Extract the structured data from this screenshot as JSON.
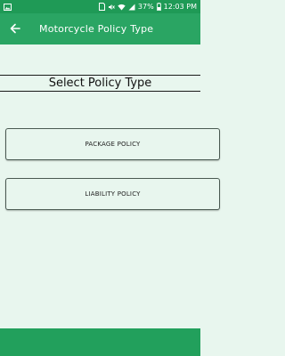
{
  "status_bar": {
    "signal_strength": "37%",
    "time": "12:03 PM",
    "icons": [
      "image-icon",
      "sim-icon",
      "mute-icon",
      "wifi-icon",
      "signal-icon",
      "battery-icon"
    ]
  },
  "app_bar": {
    "title": "Motorcycle Policy Type",
    "back_icon": "arrow-left-icon"
  },
  "main": {
    "heading": "Select Policy Type",
    "options": [
      {
        "label": "PACKAGE POLICY"
      },
      {
        "label": "LIABILITY POLICY"
      }
    ]
  },
  "colors": {
    "primary": "#2aa563",
    "status_bar": "#1f9a56",
    "background": "#e8f6ee",
    "bottom_bar": "#22a05c"
  }
}
